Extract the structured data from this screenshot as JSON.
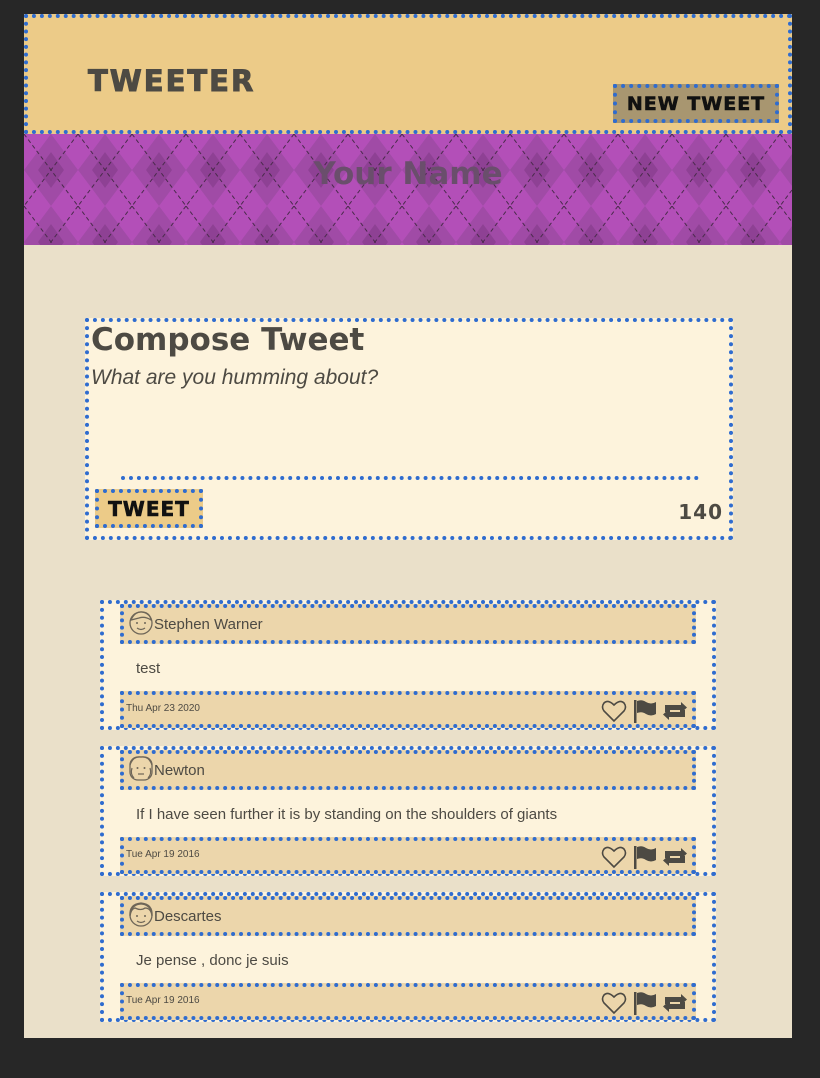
{
  "nav": {
    "brand": "Tweeter",
    "new_tweet_label": "New Tweet"
  },
  "profile": {
    "name": "Your Name"
  },
  "compose": {
    "title": "Compose Tweet",
    "placeholder": "What are you humming about?",
    "submit_label": "Tweet",
    "counter": "140"
  },
  "tweets": [
    {
      "author": "Stephen Warner",
      "text": "test",
      "date": "Thu Apr 23 2020",
      "avatar_icon": "avatar-face-icon"
    },
    {
      "author": "Newton",
      "text": "If I have seen further it is by standing on the shoulders of giants",
      "date": "Tue Apr 19 2016",
      "avatar_icon": "avatar-face-icon"
    },
    {
      "author": "Descartes",
      "text": "Je pense , donc je suis",
      "date": "Tue Apr 19 2016",
      "avatar_icon": "avatar-face-icon"
    }
  ],
  "tweet_actions": [
    "heart-icon",
    "flag-icon",
    "retweet-icon"
  ],
  "colors": {
    "background": "#eae0c9",
    "nav": "#eccb88",
    "banner": "#b34fb8",
    "card": "#fdf3dc",
    "card_band": "#ecd6ab",
    "outline": "#2f6ccf",
    "text": "#4d4a43"
  }
}
